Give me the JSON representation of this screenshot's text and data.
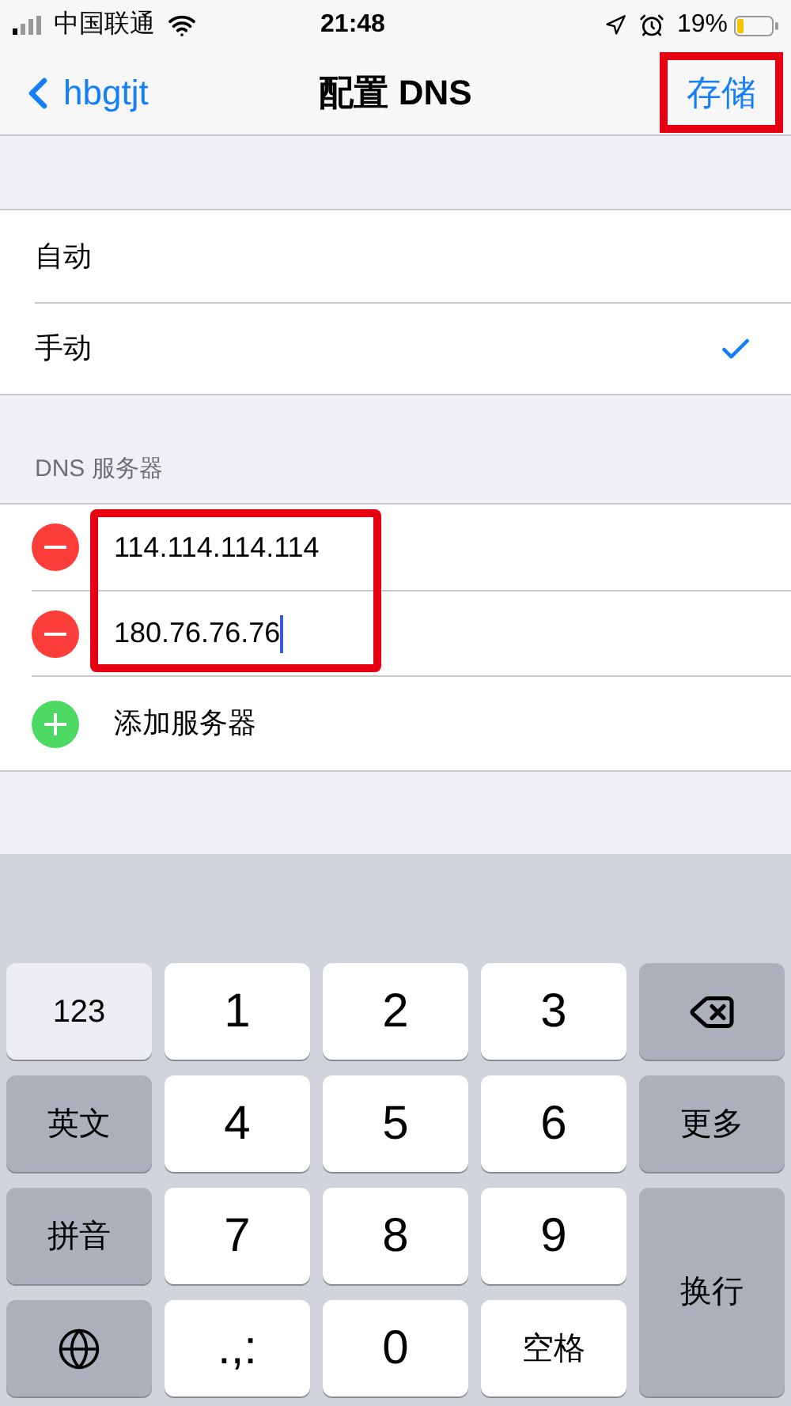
{
  "status_bar": {
    "carrier": "中国联通",
    "time": "21:48",
    "battery": "19%"
  },
  "nav": {
    "back": "hbgtjt",
    "title": "配置 DNS",
    "save": {
      "label": "存储",
      "highlighted": true
    }
  },
  "modes": [
    {
      "label": "自动",
      "selected": false
    },
    {
      "label": "手动",
      "selected": true
    }
  ],
  "dns": {
    "header": "DNS 服务器",
    "highlighted": true,
    "servers": [
      {
        "value": "114.114.114.114",
        "focused": false
      },
      {
        "value": "180.76.76.76",
        "focused": true
      }
    ],
    "add": "添加服务器"
  },
  "keyboard": [
    {
      "kind": "light",
      "label": "123"
    },
    {
      "kind": "digit",
      "label": "1"
    },
    {
      "kind": "digit",
      "label": "2"
    },
    {
      "kind": "digit",
      "label": "3"
    },
    {
      "kind": "delete"
    },
    {
      "kind": "function",
      "label": "英文"
    },
    {
      "kind": "digit",
      "label": "4"
    },
    {
      "kind": "digit",
      "label": "5"
    },
    {
      "kind": "digit",
      "label": "6"
    },
    {
      "kind": "function",
      "label": "更多"
    },
    {
      "kind": "function",
      "label": "拼音"
    },
    {
      "kind": "digit",
      "label": "7"
    },
    {
      "kind": "digit",
      "label": "8"
    },
    {
      "kind": "digit",
      "label": "9"
    },
    {
      "kind": "return",
      "label": "换行"
    },
    {
      "kind": "globe"
    },
    {
      "kind": "digit",
      "label": ".,:"
    },
    {
      "kind": "digit",
      "label": "0"
    },
    {
      "kind": "space",
      "label": "空格"
    }
  ]
}
